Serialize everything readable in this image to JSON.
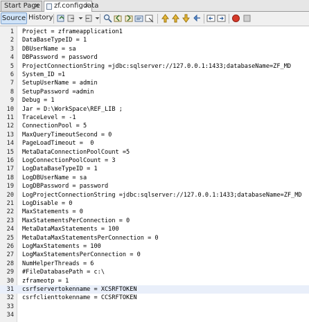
{
  "tabs": [
    {
      "label": "Start Page"
    },
    {
      "label": "zf.configdata"
    }
  ],
  "toolbar": {
    "source_label": "Source",
    "history_label": "History",
    "icons": [
      "last-edit-icon",
      "back-icon",
      "forward-icon",
      "find-icon",
      "find-previous-icon",
      "find-next-icon",
      "find-selection-icon",
      "toggle-highlight-icon",
      "toggle-rectangular-selection-icon",
      "previous-bookmark-icon",
      "next-bookmark-icon",
      "toggle-bookmark-icon",
      "shift-left-icon",
      "shift-right-icon",
      "start-macro-icon",
      "stop-macro-icon"
    ]
  },
  "editor": {
    "highlighted_line": 31,
    "lines": [
      {
        "num": "1",
        "text": "Project = zframeapplication1"
      },
      {
        "num": "2",
        "text": "DataBaseTypeID = 1"
      },
      {
        "num": "3",
        "text": "DBUserName = sa"
      },
      {
        "num": "4",
        "text": "DBPassword = password"
      },
      {
        "num": "5",
        "text": "ProjectConnectionString =jdbc:sqlserver://127.0.0.1:1433;databaseName=ZF_MD"
      },
      {
        "num": "6",
        "text": "System_ID =1"
      },
      {
        "num": "7",
        "text": "SetupUserName = admin"
      },
      {
        "num": "8",
        "text": "SetupPassword =admin"
      },
      {
        "num": "9",
        "text": "Debug = 1"
      },
      {
        "num": "10",
        "text": "Jar = D:\\WorkSpace\\REF_LIB ;"
      },
      {
        "num": "11",
        "text": "TraceLevel = -1"
      },
      {
        "num": "12",
        "text": "ConnectionPool = 5"
      },
      {
        "num": "13",
        "text": "MaxQueryTimeoutSecond = 0"
      },
      {
        "num": "14",
        "text": "PageLoadTimeout =  0"
      },
      {
        "num": "15",
        "text": "MetaDataConnectionPoolCount =5"
      },
      {
        "num": "16",
        "text": "LogConnectionPoolCount = 3"
      },
      {
        "num": "17",
        "text": "LogDataBaseTypeID = 1"
      },
      {
        "num": "18",
        "text": "LogDBUserName = sa"
      },
      {
        "num": "19",
        "text": "LogDBPassword = password"
      },
      {
        "num": "20",
        "text": "LogProjectConnectionString =jdbc:sqlserver://127.0.0.1:1433;databaseName=ZF_MD"
      },
      {
        "num": "21",
        "text": "LogDisable = 0"
      },
      {
        "num": "22",
        "text": "MaxStatements = 0"
      },
      {
        "num": "23",
        "text": "MaxStatementsPerConnection = 0"
      },
      {
        "num": "24",
        "text": "MetaDataMaxStatements = 100"
      },
      {
        "num": "25",
        "text": "MetaDataMaxStatementsPerConnection = 0"
      },
      {
        "num": "26",
        "text": "LogMaxStatements = 100"
      },
      {
        "num": "27",
        "text": "LogMaxStatementsPerConnection = 0"
      },
      {
        "num": "28",
        "text": "NumHelperThreads = 6"
      },
      {
        "num": "29",
        "text": "#FileDatabasePath = c:\\"
      },
      {
        "num": "30",
        "text": "zframeotp = 1"
      },
      {
        "num": "31",
        "text": "csrfservertokenname = XCSRFTOKEN"
      },
      {
        "num": "32",
        "text": "csrfclienttokenname = CCSRFTOKEN"
      },
      {
        "num": "33",
        "text": ""
      },
      {
        "num": "34",
        "text": ""
      }
    ]
  }
}
